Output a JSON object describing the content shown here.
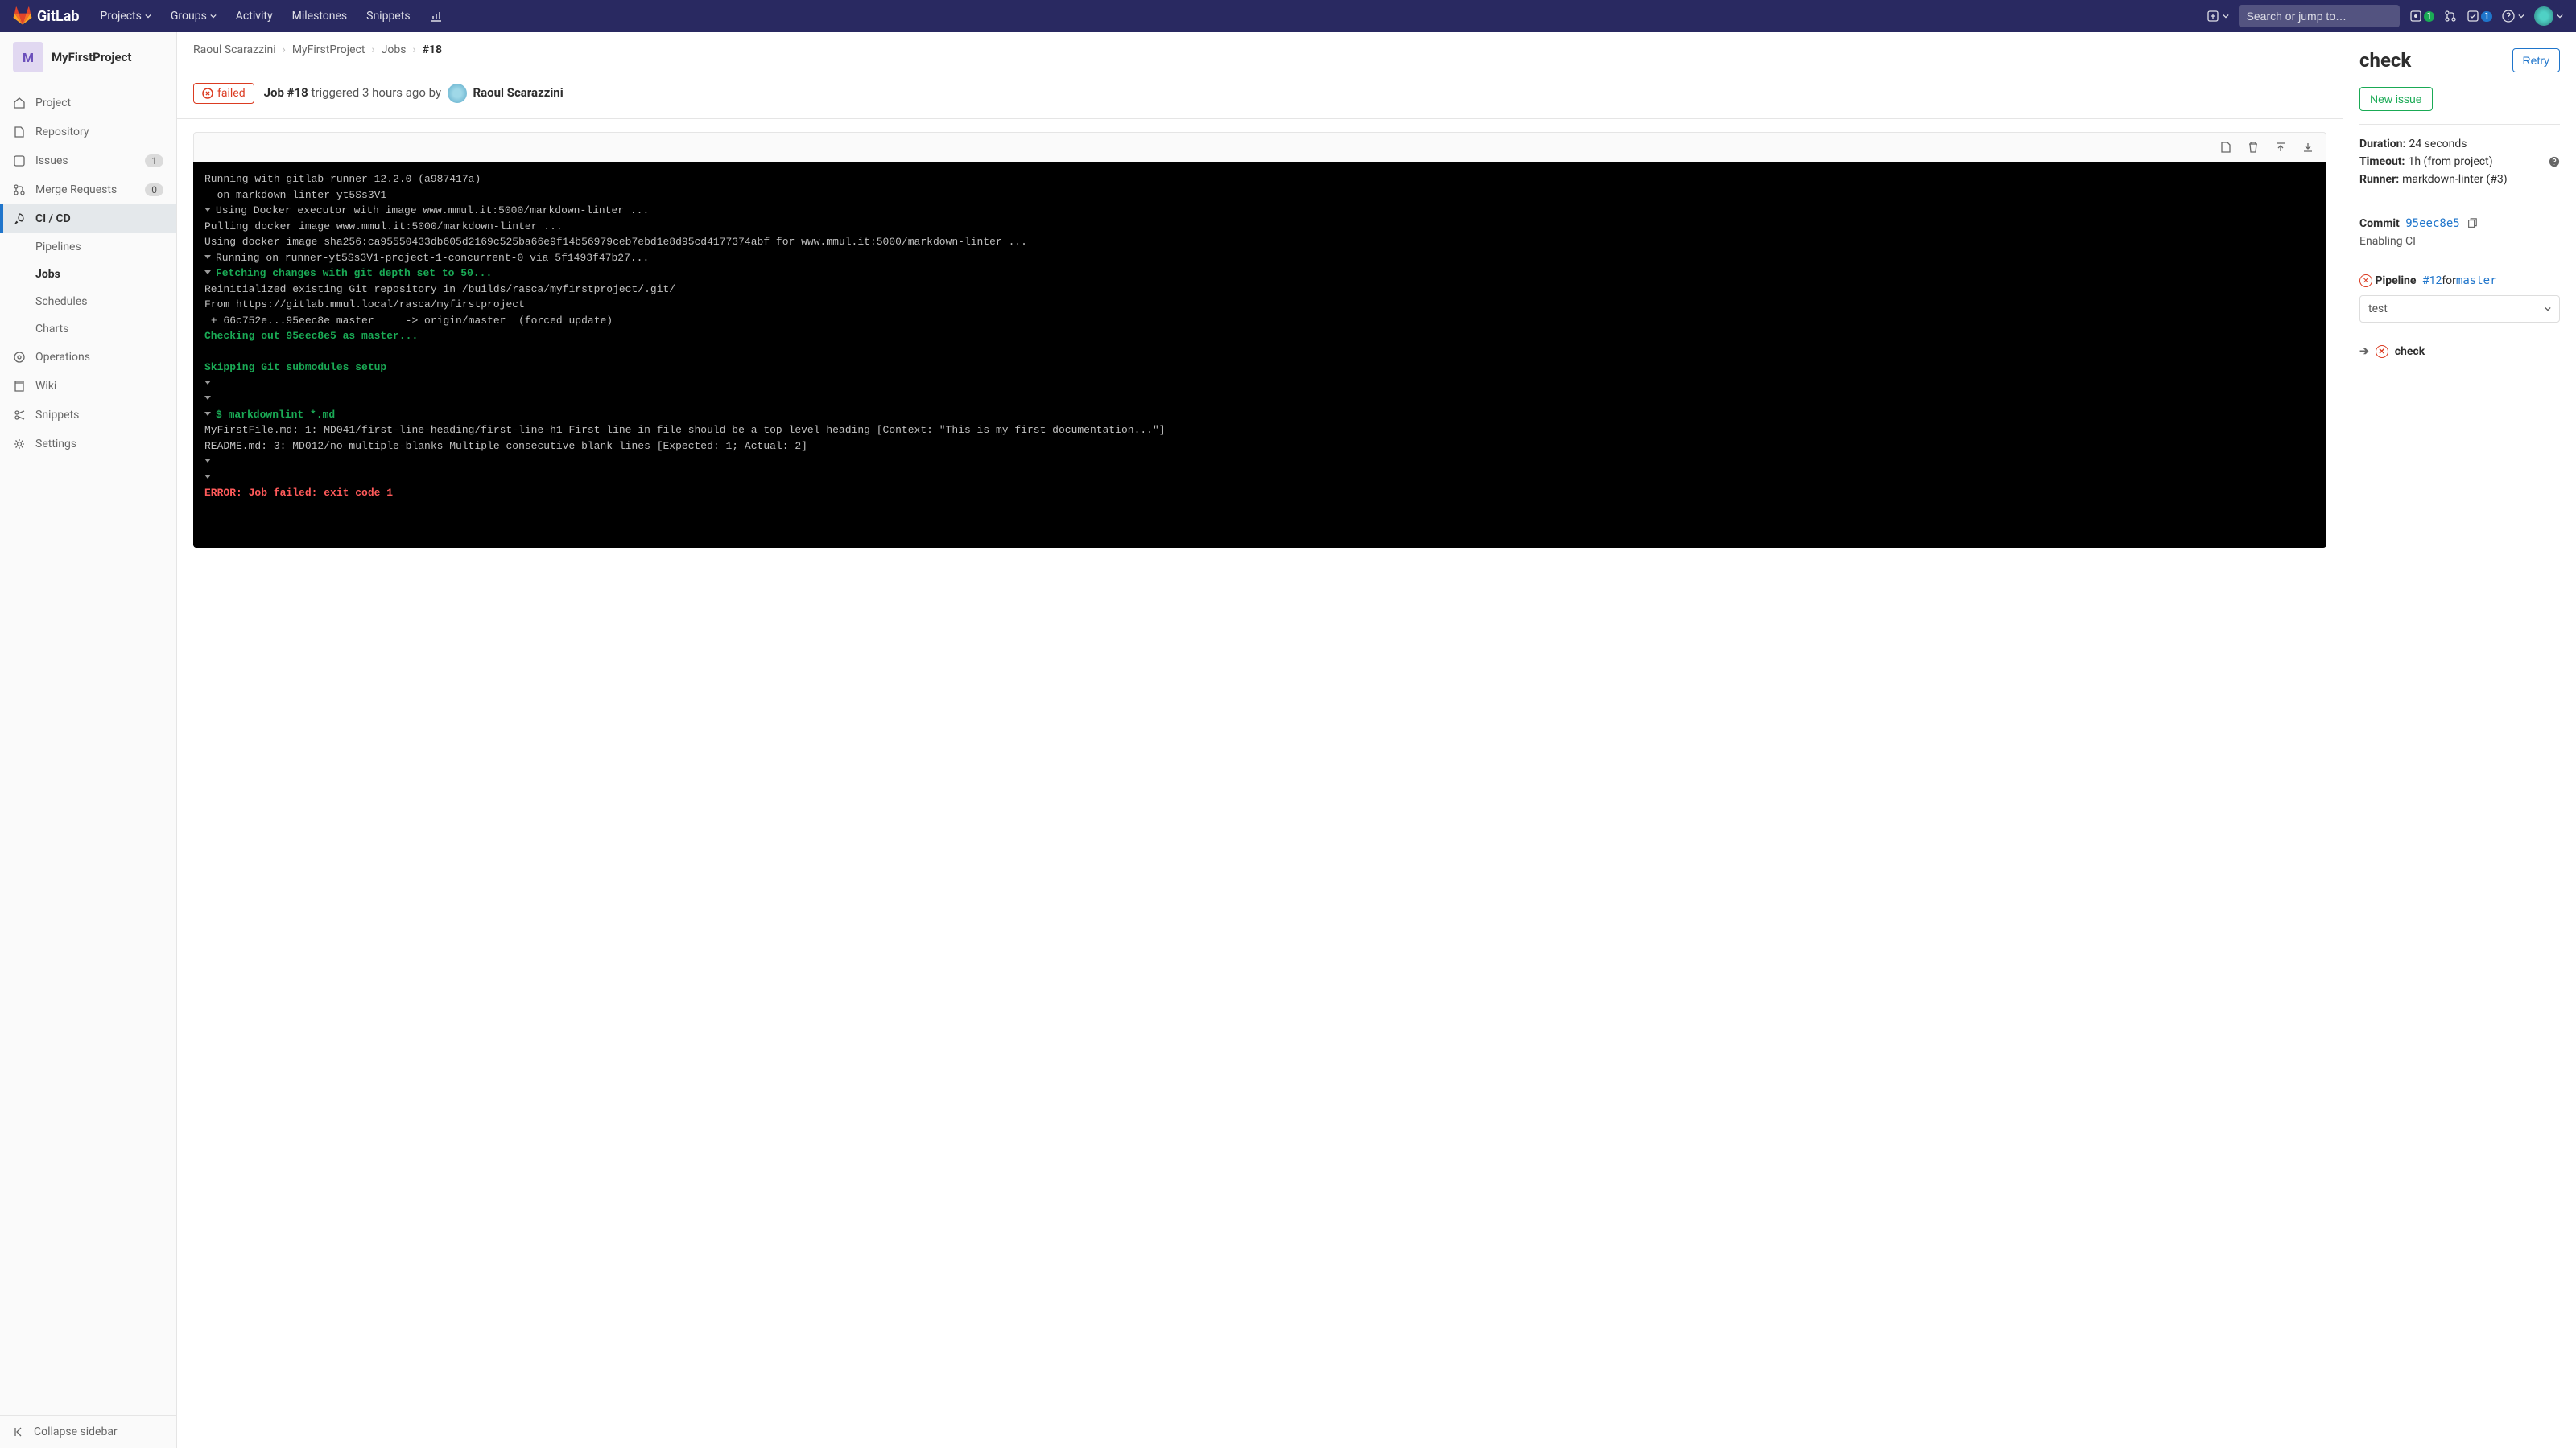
{
  "brand": "GitLab",
  "top_nav": {
    "projects": "Projects",
    "groups": "Groups",
    "activity": "Activity",
    "milestones": "Milestones",
    "snippets": "Snippets"
  },
  "search": {
    "placeholder": "Search or jump to…"
  },
  "counters": {
    "issues": "1",
    "todos": "1"
  },
  "project": {
    "initial": "M",
    "name": "MyFirstProject"
  },
  "sidebar": {
    "project": "Project",
    "repository": "Repository",
    "issues": "Issues",
    "issues_count": "1",
    "merge_requests": "Merge Requests",
    "mr_count": "0",
    "cicd": "CI / CD",
    "pipelines": "Pipelines",
    "jobs": "Jobs",
    "schedules": "Schedules",
    "charts": "Charts",
    "operations": "Operations",
    "wiki": "Wiki",
    "snippets": "Snippets",
    "settings": "Settings",
    "collapse": "Collapse sidebar"
  },
  "breadcrumbs": {
    "owner": "Raoul Scarazzini",
    "project": "MyFirstProject",
    "jobs": "Jobs",
    "current": "#18"
  },
  "job": {
    "status": "failed",
    "title_prefix": "Job #18",
    "triggered": " triggered 3 hours ago by ",
    "user": "Raoul Scarazzini"
  },
  "log": {
    "l1": "Running with gitlab-runner 12.2.0 (a987417a)",
    "l2": "  on markdown-linter yt5Ss3V1",
    "l3": "Using Docker executor with image www.mmul.it:5000/markdown-linter ...",
    "l4": "Pulling docker image www.mmul.it:5000/markdown-linter ...",
    "l5": "Using docker image sha256:ca95550433db605d2169c525ba66e9f14b56979ceb7ebd1e8d95cd4177374abf for www.mmul.it:5000/markdown-linter ...",
    "l6": "Running on runner-yt5Ss3V1-project-1-concurrent-0 via 5f1493f47b27...",
    "l7": "Fetching changes with git depth set to 50...",
    "l8": "Reinitialized existing Git repository in /builds/rasca/myfirstproject/.git/",
    "l9": "From https://gitlab.mmul.local/rasca/myfirstproject",
    "l10": " + 66c752e...95eec8e master     -> origin/master  (forced update)",
    "l11": "Checking out 95eec8e5 as master...",
    "l12": "Skipping Git submodules setup",
    "l13": "$ markdownlint *.md",
    "l14": "MyFirstFile.md: 1: MD041/first-line-heading/first-line-h1 First line in file should be a top level heading [Context: \"This is my first documentation...\"]",
    "l15": "README.md: 3: MD012/no-multiple-blanks Multiple consecutive blank lines [Expected: 1; Actual: 2]",
    "l16": "ERROR: Job failed: exit code 1"
  },
  "panel": {
    "title": "check",
    "retry": "Retry",
    "new_issue": "New issue",
    "duration_label": "Duration:",
    "duration": "24 seconds",
    "timeout_label": "Timeout:",
    "timeout": "1h (from project)",
    "runner_label": "Runner:",
    "runner": "markdown-linter (#3)",
    "commit_label": "Commit",
    "commit_sha": "95eec8e5",
    "commit_msg": "Enabling CI",
    "pipeline_label": "Pipeline",
    "pipeline_id": "#12",
    "pipeline_for": " for ",
    "pipeline_ref": "master",
    "stage": "test",
    "job_name": "check"
  }
}
